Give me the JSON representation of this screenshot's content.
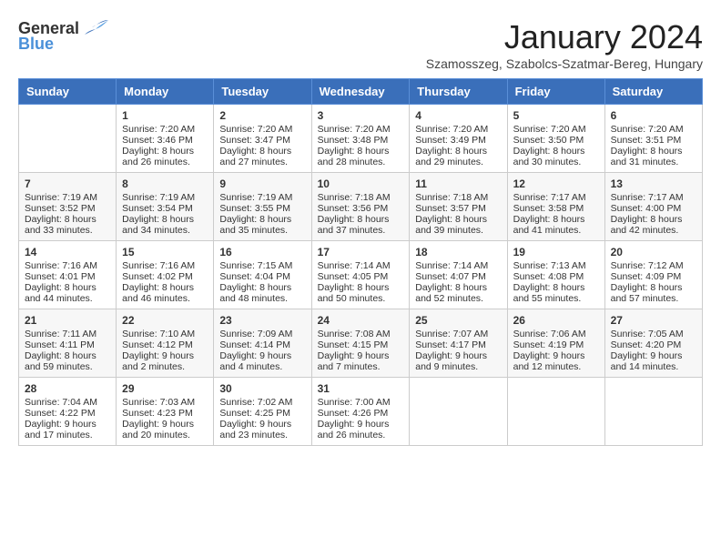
{
  "logo": {
    "general": "General",
    "blue": "Blue"
  },
  "header": {
    "month": "January 2024",
    "location": "Szamosszeg, Szabolcs-Szatmar-Bereg, Hungary"
  },
  "weekdays": [
    "Sunday",
    "Monday",
    "Tuesday",
    "Wednesday",
    "Thursday",
    "Friday",
    "Saturday"
  ],
  "weeks": [
    [
      {
        "day": "",
        "info": ""
      },
      {
        "day": "1",
        "info": "Sunrise: 7:20 AM\nSunset: 3:46 PM\nDaylight: 8 hours\nand 26 minutes."
      },
      {
        "day": "2",
        "info": "Sunrise: 7:20 AM\nSunset: 3:47 PM\nDaylight: 8 hours\nand 27 minutes."
      },
      {
        "day": "3",
        "info": "Sunrise: 7:20 AM\nSunset: 3:48 PM\nDaylight: 8 hours\nand 28 minutes."
      },
      {
        "day": "4",
        "info": "Sunrise: 7:20 AM\nSunset: 3:49 PM\nDaylight: 8 hours\nand 29 minutes."
      },
      {
        "day": "5",
        "info": "Sunrise: 7:20 AM\nSunset: 3:50 PM\nDaylight: 8 hours\nand 30 minutes."
      },
      {
        "day": "6",
        "info": "Sunrise: 7:20 AM\nSunset: 3:51 PM\nDaylight: 8 hours\nand 31 minutes."
      }
    ],
    [
      {
        "day": "7",
        "info": "Sunrise: 7:19 AM\nSunset: 3:52 PM\nDaylight: 8 hours\nand 33 minutes."
      },
      {
        "day": "8",
        "info": "Sunrise: 7:19 AM\nSunset: 3:54 PM\nDaylight: 8 hours\nand 34 minutes."
      },
      {
        "day": "9",
        "info": "Sunrise: 7:19 AM\nSunset: 3:55 PM\nDaylight: 8 hours\nand 35 minutes."
      },
      {
        "day": "10",
        "info": "Sunrise: 7:18 AM\nSunset: 3:56 PM\nDaylight: 8 hours\nand 37 minutes."
      },
      {
        "day": "11",
        "info": "Sunrise: 7:18 AM\nSunset: 3:57 PM\nDaylight: 8 hours\nand 39 minutes."
      },
      {
        "day": "12",
        "info": "Sunrise: 7:17 AM\nSunset: 3:58 PM\nDaylight: 8 hours\nand 41 minutes."
      },
      {
        "day": "13",
        "info": "Sunrise: 7:17 AM\nSunset: 4:00 PM\nDaylight: 8 hours\nand 42 minutes."
      }
    ],
    [
      {
        "day": "14",
        "info": "Sunrise: 7:16 AM\nSunset: 4:01 PM\nDaylight: 8 hours\nand 44 minutes."
      },
      {
        "day": "15",
        "info": "Sunrise: 7:16 AM\nSunset: 4:02 PM\nDaylight: 8 hours\nand 46 minutes."
      },
      {
        "day": "16",
        "info": "Sunrise: 7:15 AM\nSunset: 4:04 PM\nDaylight: 8 hours\nand 48 minutes."
      },
      {
        "day": "17",
        "info": "Sunrise: 7:14 AM\nSunset: 4:05 PM\nDaylight: 8 hours\nand 50 minutes."
      },
      {
        "day": "18",
        "info": "Sunrise: 7:14 AM\nSunset: 4:07 PM\nDaylight: 8 hours\nand 52 minutes."
      },
      {
        "day": "19",
        "info": "Sunrise: 7:13 AM\nSunset: 4:08 PM\nDaylight: 8 hours\nand 55 minutes."
      },
      {
        "day": "20",
        "info": "Sunrise: 7:12 AM\nSunset: 4:09 PM\nDaylight: 8 hours\nand 57 minutes."
      }
    ],
    [
      {
        "day": "21",
        "info": "Sunrise: 7:11 AM\nSunset: 4:11 PM\nDaylight: 8 hours\nand 59 minutes."
      },
      {
        "day": "22",
        "info": "Sunrise: 7:10 AM\nSunset: 4:12 PM\nDaylight: 9 hours\nand 2 minutes."
      },
      {
        "day": "23",
        "info": "Sunrise: 7:09 AM\nSunset: 4:14 PM\nDaylight: 9 hours\nand 4 minutes."
      },
      {
        "day": "24",
        "info": "Sunrise: 7:08 AM\nSunset: 4:15 PM\nDaylight: 9 hours\nand 7 minutes."
      },
      {
        "day": "25",
        "info": "Sunrise: 7:07 AM\nSunset: 4:17 PM\nDaylight: 9 hours\nand 9 minutes."
      },
      {
        "day": "26",
        "info": "Sunrise: 7:06 AM\nSunset: 4:19 PM\nDaylight: 9 hours\nand 12 minutes."
      },
      {
        "day": "27",
        "info": "Sunrise: 7:05 AM\nSunset: 4:20 PM\nDaylight: 9 hours\nand 14 minutes."
      }
    ],
    [
      {
        "day": "28",
        "info": "Sunrise: 7:04 AM\nSunset: 4:22 PM\nDaylight: 9 hours\nand 17 minutes."
      },
      {
        "day": "29",
        "info": "Sunrise: 7:03 AM\nSunset: 4:23 PM\nDaylight: 9 hours\nand 20 minutes."
      },
      {
        "day": "30",
        "info": "Sunrise: 7:02 AM\nSunset: 4:25 PM\nDaylight: 9 hours\nand 23 minutes."
      },
      {
        "day": "31",
        "info": "Sunrise: 7:00 AM\nSunset: 4:26 PM\nDaylight: 9 hours\nand 26 minutes."
      },
      {
        "day": "",
        "info": ""
      },
      {
        "day": "",
        "info": ""
      },
      {
        "day": "",
        "info": ""
      }
    ]
  ]
}
